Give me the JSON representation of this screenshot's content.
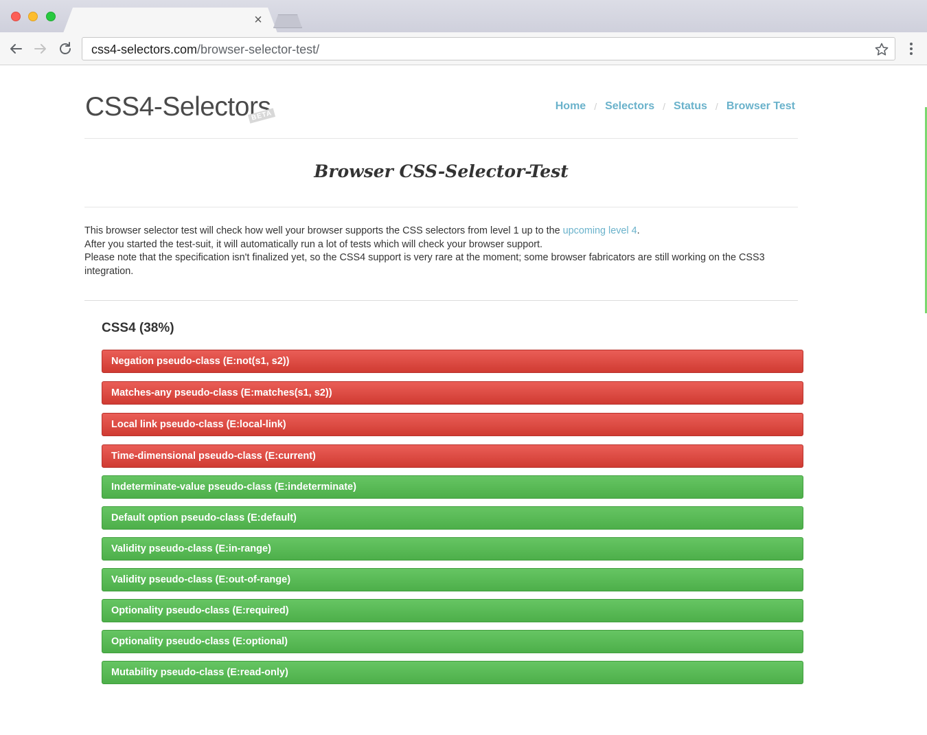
{
  "browser": {
    "url_host": "css4-selectors.com",
    "url_path": "/browser-selector-test/",
    "tab_close_glyph": "×",
    "icons": [
      "back-arrow-icon",
      "forward-arrow-icon",
      "reload-icon",
      "star-icon",
      "menu-dots-icon"
    ]
  },
  "site": {
    "logo": "CSS4-Selectors",
    "beta_badge": "BETA"
  },
  "nav": {
    "items": [
      {
        "label": "Home"
      },
      {
        "label": "Selectors"
      },
      {
        "label": "Status"
      },
      {
        "label": "Browser Test"
      }
    ],
    "separator": "/"
  },
  "main": {
    "title": "Browser CSS-Selector-Test",
    "intro": {
      "line1_before_link": "This browser selector test will check how well your browser supports the CSS selectors from level 1 up to the ",
      "line1_link": "upcoming level 4",
      "line1_after_link": ".",
      "line2": "After you started the test-suit, it will automatically run a lot of tests which will check your browser support.",
      "line3": "Please note that the specification isn't finalized yet, so the CSS4 support is very rare at the moment; some browser fabricators are still working on the CSS3 integration."
    },
    "section_heading": "CSS4 (38%)",
    "results": [
      {
        "label": "Negation pseudo-class (E:not(s1, s2))",
        "status": "fail"
      },
      {
        "label": "Matches-any pseudo-class (E:matches(s1, s2))",
        "status": "fail"
      },
      {
        "label": "Local link pseudo-class (E:local-link)",
        "status": "fail"
      },
      {
        "label": "Time-dimensional pseudo-class (E:current)",
        "status": "fail"
      },
      {
        "label": "Indeterminate-value pseudo-class (E:indeterminate)",
        "status": "pass"
      },
      {
        "label": "Default option pseudo-class (E:default)",
        "status": "pass"
      },
      {
        "label": "Validity pseudo-class (E:in-range)",
        "status": "pass"
      },
      {
        "label": "Validity pseudo-class (E:out-of-range)",
        "status": "pass"
      },
      {
        "label": "Optionality pseudo-class (E:required)",
        "status": "pass"
      },
      {
        "label": "Optionality pseudo-class (E:optional)",
        "status": "pass"
      },
      {
        "label": "Mutability pseudo-class (E:read-only)",
        "status": "pass"
      }
    ]
  },
  "colors": {
    "link": "#6ab2cb",
    "fail": "#d9453d",
    "pass": "#56b853",
    "text": "#333333"
  }
}
